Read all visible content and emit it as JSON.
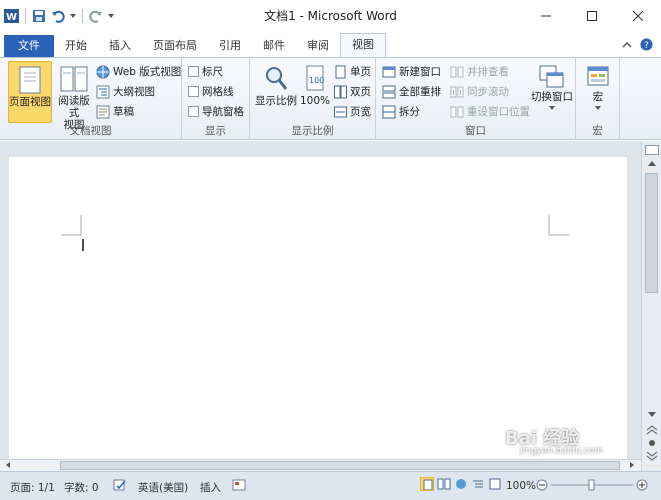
{
  "app": {
    "title": "文档1 - Microsoft Word"
  },
  "tabs": [
    {
      "label": "文件"
    },
    {
      "label": "开始"
    },
    {
      "label": "插入"
    },
    {
      "label": "页面布局"
    },
    {
      "label": "引用"
    },
    {
      "label": "邮件"
    },
    {
      "label": "审阅"
    },
    {
      "label": "视图"
    }
  ],
  "ribbon": {
    "doc_views": {
      "name": "文档视图",
      "page_view": "页面视图",
      "reading_view_line1": "阅读版式",
      "reading_view_line2": "视图",
      "web_view": "Web 版式视图",
      "outline": "大纲视图",
      "draft": "草稿"
    },
    "show": {
      "name": "显示",
      "ruler": "标尺",
      "gridlines": "网格线",
      "nav_pane": "导航窗格"
    },
    "zoom": {
      "name": "显示比例",
      "zoom": "显示比例",
      "percent": "100%",
      "one_page": "单页",
      "two_pages": "双页",
      "page_width": "页宽"
    },
    "window": {
      "name": "窗口",
      "new_window": "新建窗口",
      "arrange_all": "全部重排",
      "split": "拆分",
      "side_by_side": "并排查看",
      "sync_scroll": "同步滚动",
      "reset_pos": "重设窗口位置",
      "switch_windows": "切换窗口"
    },
    "macros": {
      "name": "宏",
      "macros": "宏"
    }
  },
  "status": {
    "page": "页面: 1/1",
    "words": "字数: 0",
    "language": "英语(美国)",
    "insert_mode": "插入",
    "zoom": "100%"
  },
  "watermark": "Bai 经验",
  "watermark_url": "jingyan.baidu.com"
}
